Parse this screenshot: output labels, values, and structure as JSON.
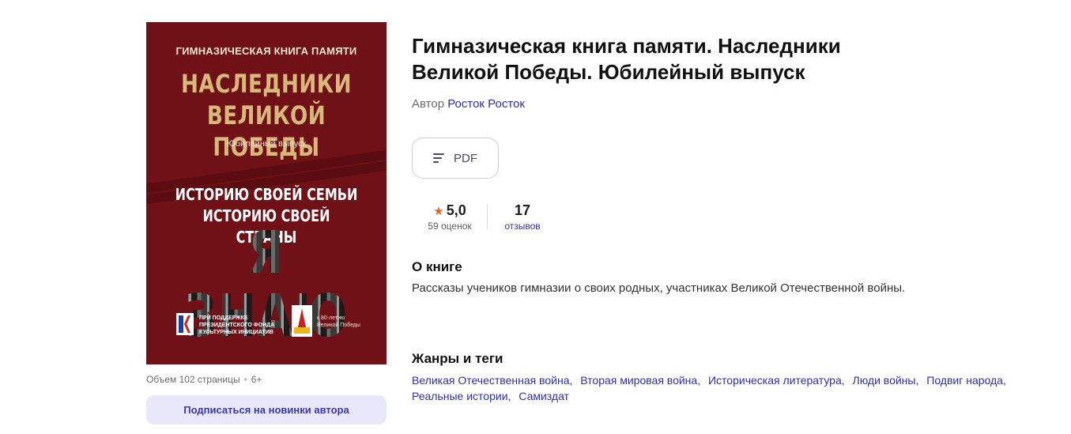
{
  "cover": {
    "series": "ГИМНАЗИЧЕСКАЯ КНИГА ПАМЯТИ",
    "title_line1": "НАСЛЕДНИКИ",
    "title_line2": "ВЕЛИКОЙ ПОБЕДЫ",
    "subtitle": "Юбилейный выпуск",
    "slogan_line1": "ИСТОРИЮ СВОЕЙ СЕМЬИ",
    "slogan_line2": "ИСТОРИЮ СВОЕЙ СТРАНЫ",
    "big_text": "Я ЗНАЮ",
    "fund_line1": "ПРИ ПОДДЕРЖКЕ",
    "fund_line2": "ПРЕЗИДЕНТСКОГО ФОНДА",
    "fund_line3": "КУЛЬТУРНЫХ ИНИЦИАТИВ",
    "anniv_line1": "к 80-летию",
    "anniv_line2": "Великой Победы",
    "colors": {
      "background": "#701117",
      "title": "#d9b87c"
    }
  },
  "meta": {
    "volume": "Объем 102 страницы",
    "age": "6+"
  },
  "subscribe_label": "Подписаться на новинки автора",
  "book": {
    "title": "Гимназическая книга памяти. Наследники Великой Победы. Юбилейный выпуск",
    "author_prefix": "Автор",
    "author_name": "Росток Росток"
  },
  "format": {
    "label": "PDF",
    "icon": "list-lines-icon"
  },
  "rating": {
    "value": "5,0",
    "count_label": "59 оценок",
    "star_icon": "star-icon",
    "star_color": "#f0621c"
  },
  "reviews": {
    "count": "17",
    "label": "отзывов"
  },
  "about": {
    "heading": "О книге",
    "text": "Рассказы учеников гимназии о своих родных, участниках Великой Отечественной войны."
  },
  "tags": {
    "heading": "Жанры и теги",
    "items": [
      "Великая Отечественная война",
      "Вторая мировая война",
      "Историческая литература",
      "Люди войны",
      "Подвиг народа",
      "Реальные истории",
      "Самиздат"
    ]
  },
  "accent_color": "#2f2fb0"
}
